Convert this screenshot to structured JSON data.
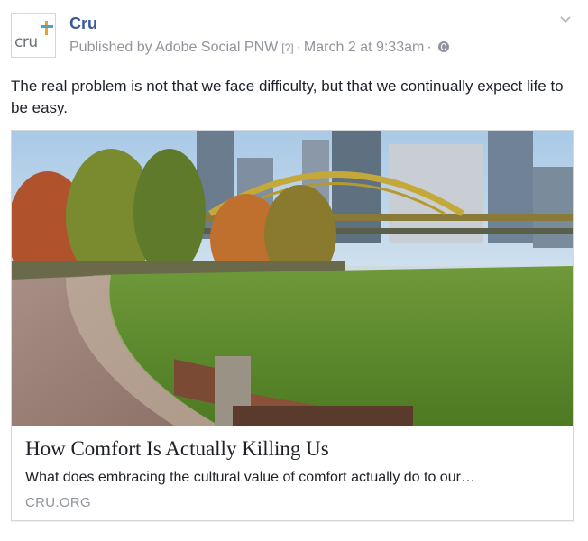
{
  "page": {
    "name": "Cru",
    "avatar_text": "cru",
    "published_by": "Published by Adobe Social PNW",
    "help_badge": "[?]",
    "separator": "·",
    "timestamp": "March 2 at 9:33am",
    "audience_icon": "globe-icon",
    "menu_icon": "chevron-down-icon"
  },
  "post": {
    "text": "The real problem is not that we face difficulty, but that we continually expect life to be easy."
  },
  "link_card": {
    "image_description_icon": "photo",
    "title": "How Comfort Is Actually Killing Us",
    "description": "What does embracing the cultural value of comfort actually do to our…",
    "domain": "CRU.ORG"
  },
  "colors": {
    "brand_blue": "#3b5998",
    "meta_gray": "#90949c",
    "text": "#1d2129",
    "logo_orange": "#e8a32a",
    "logo_blue": "#4aa3c8"
  }
}
